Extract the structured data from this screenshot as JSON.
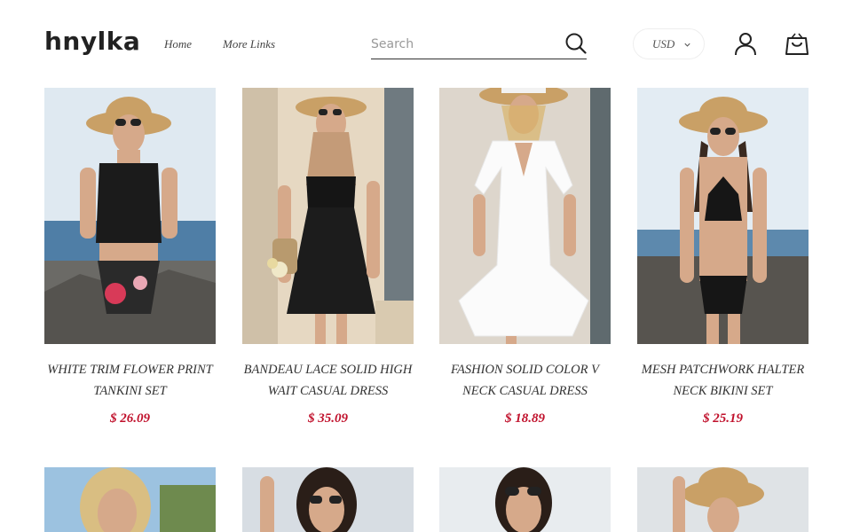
{
  "brand": {
    "logo": "hnylka"
  },
  "nav": {
    "home": "Home",
    "more": "More Links"
  },
  "search": {
    "placeholder": "Search"
  },
  "currency": {
    "selected": "USD"
  },
  "icons": {
    "search": "search-icon",
    "account": "user-icon",
    "cart": "shopping-bag-icon",
    "currency_dropdown": "chevron-down-icon"
  },
  "colors": {
    "price": "#c0102b",
    "text": "#333333"
  },
  "products": [
    {
      "title": "WHITE TRIM FLOWER PRINT TANKINI SET",
      "price": "$ 26.09"
    },
    {
      "title": "BANDEAU LACE SOLID HIGH WAIT CASUAL DRESS",
      "price": "$ 35.09"
    },
    {
      "title": "FASHION SOLID COLOR V NECK CASUAL DRESS",
      "price": "$ 18.89"
    },
    {
      "title": "MESH PATCHWORK HALTER NECK BIKINI SET",
      "price": "$ 25.19"
    }
  ]
}
